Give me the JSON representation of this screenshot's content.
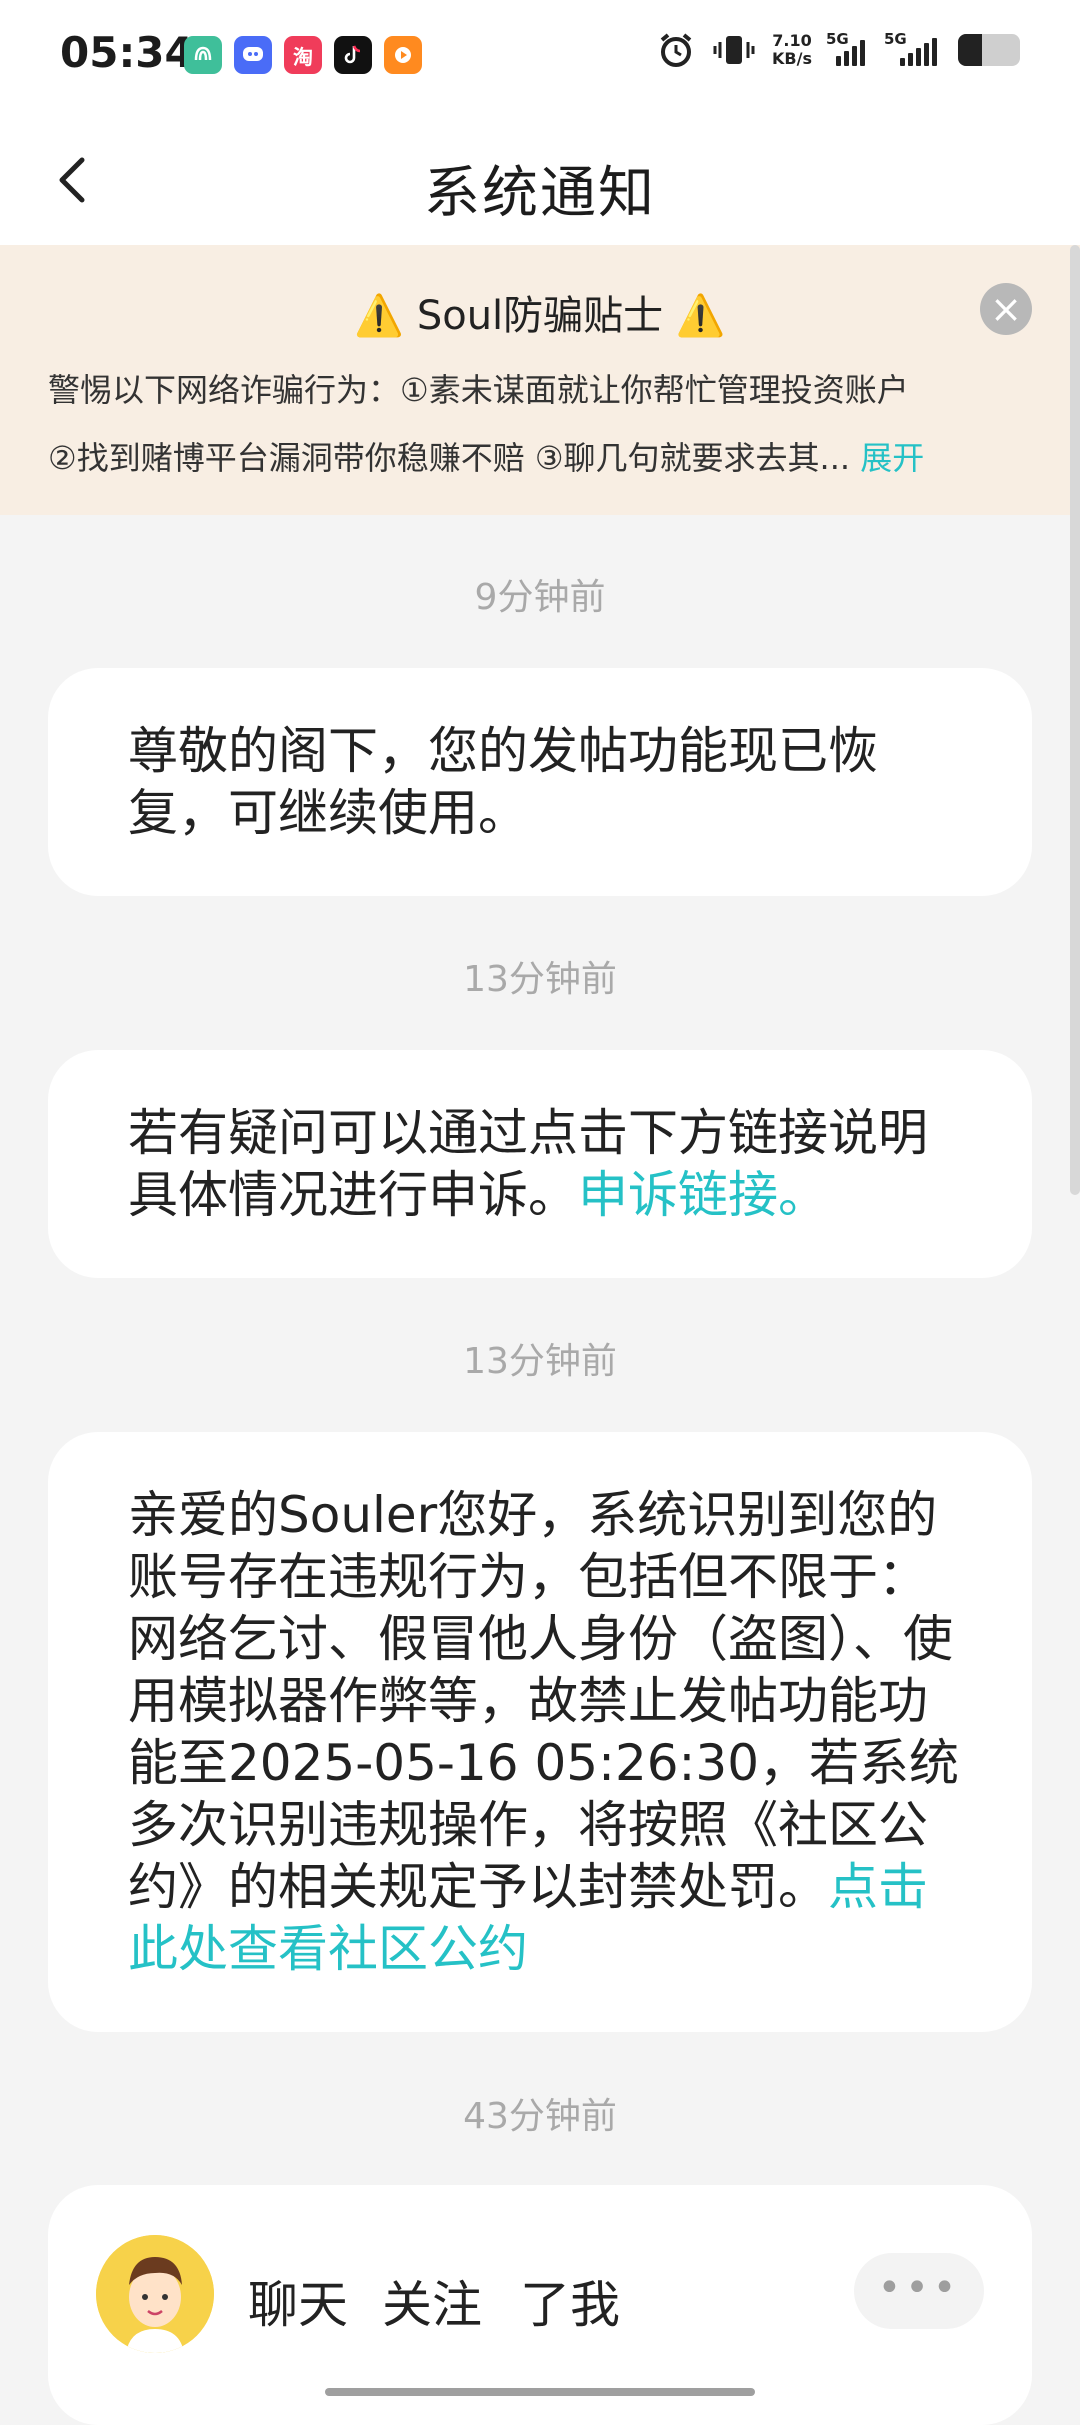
{
  "status_bar": {
    "time": "05:34",
    "net_speed_value": "7.10",
    "net_speed_unit": "KB/s",
    "signal1_label": "5G",
    "signal2_label": "5G",
    "app_icons": [
      "fingerprint-app-icon",
      "chat-bubble-app-icon",
      "taobao-app-icon",
      "tiktok-app-icon",
      "video-app-icon"
    ],
    "taobao_glyph": "淘"
  },
  "header": {
    "title": "系统通知"
  },
  "notice": {
    "title": "Soul防骗贴士",
    "line1": "警惕以下网络诈骗行为：①素未谋面就让你帮忙管理投资账户",
    "line2": "②找到赌博平台漏洞带你稳赚不赔 ③聊几句就要求去其...",
    "expand": "展开",
    "close_glyph": "×"
  },
  "messages": [
    {
      "time": "9分钟前",
      "text": "尊敬的阁下，您的发帖功能现已恢复，可继续使用。"
    },
    {
      "time": "13分钟前",
      "text": "若有疑问可以通过点击下方链接说明具体情况进行申诉。",
      "link": "申诉链接。"
    },
    {
      "time": "13分钟前",
      "text": "亲爱的Souler您好，系统识别到您的账号存在违规行为，包括但不限于：网络乞讨、假冒他人身份（盗图）、使用模拟器作弊等，故禁止发帖功能功能至2025-05-16 05:26:30，若系统多次识别违规操作，将按照《社区公约》的相关规定予以封禁处罚。",
      "link": "点击此处查看社区公约"
    },
    {
      "time": "43分钟前",
      "actions": [
        "聊天",
        "关注",
        "了我"
      ],
      "more": "•••"
    }
  ],
  "colors": {
    "accent_link": "#25c1c6",
    "notice_bg": "#f8eee3",
    "page_bg": "#f4f4f4"
  }
}
